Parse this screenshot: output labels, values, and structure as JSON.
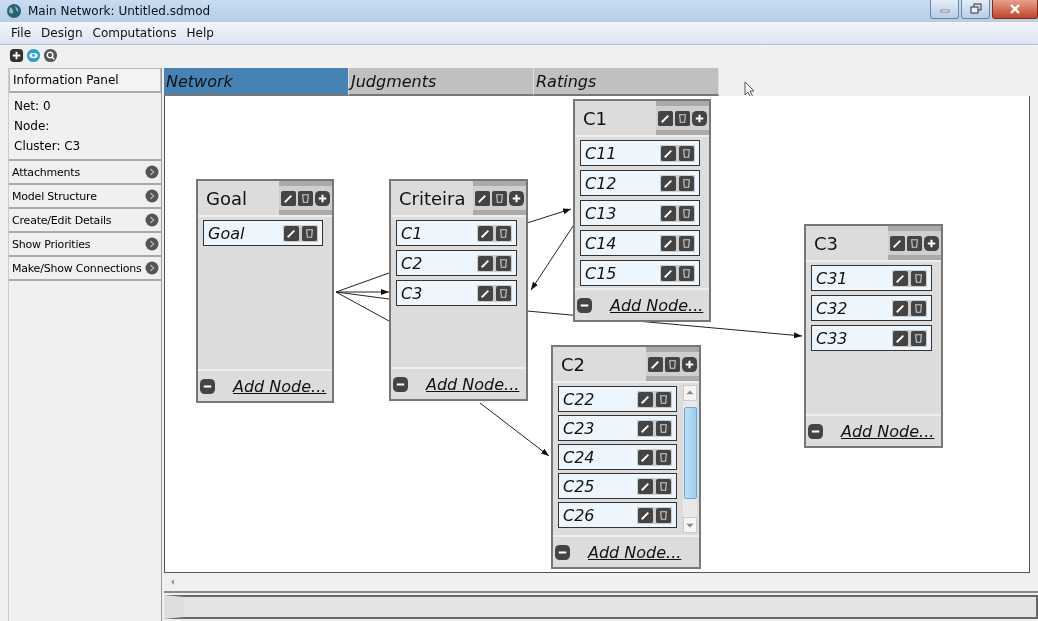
{
  "window": {
    "title": "Main Network: Untitled.sdmod"
  },
  "menu": [
    "File",
    "Design",
    "Computations",
    "Help"
  ],
  "info_panel": {
    "title": "Information Panel",
    "lines": [
      "Net: 0",
      "Node:",
      "Cluster: C3"
    ]
  },
  "panel_sections": [
    "Attachments",
    "Model Structure",
    "Create/Edit Details",
    "Show Priorities",
    "Make/Show Connections"
  ],
  "tabs": [
    {
      "label": "Network",
      "selected": true
    },
    {
      "label": "Judgments",
      "selected": false
    },
    {
      "label": "Ratings",
      "selected": false
    }
  ],
  "clusters": [
    {
      "title": "Goal",
      "nodes": [
        "Goal"
      ],
      "add_label": "Add Node..."
    },
    {
      "title": "Criteira",
      "nodes": [
        "C1",
        "C2",
        "C3"
      ],
      "add_label": "Add Node..."
    },
    {
      "title": "C1",
      "nodes": [
        "C11",
        "C12",
        "C13",
        "C14",
        "C15"
      ],
      "add_label": "Add Node..."
    },
    {
      "title": "C2",
      "nodes": [
        "C22",
        "C23",
        "C24",
        "C25",
        "C26"
      ],
      "add_label": "Add Node..."
    },
    {
      "title": "C3",
      "nodes": [
        "C31",
        "C32",
        "C33"
      ],
      "add_label": "Add Node..."
    }
  ]
}
